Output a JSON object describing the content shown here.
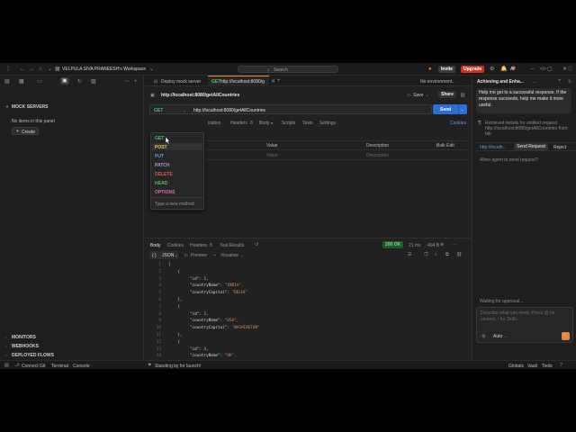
{
  "titlebar": {
    "workspace": "VELPULA SIVA PRANEESH's Workspace",
    "search_placeholder": "Search",
    "invite": "Invite",
    "upgrade": "Upgrade"
  },
  "left": {
    "section_title": "MOCK SERVERS",
    "empty": "No items in this panel",
    "create": "Create",
    "bottom_sections": [
      "MONITORS",
      "WEBHOOKS",
      "DEPLOYED FLOWS"
    ]
  },
  "tabs": {
    "tab1": "Deploy mock server",
    "tab2_method": "GET",
    "tab2_label": "http://localhost:8080/g",
    "no_environment": "No environment"
  },
  "request": {
    "title": "http://localhost:8080/getAllCountries",
    "save": "Save",
    "share": "Share",
    "method": "GET",
    "url": "http://localhost:8080/getAllCountries",
    "send": "Send",
    "subtabs": [
      "ization",
      "Headers",
      "8",
      "Body",
      "Scripts",
      "Tests",
      "Settings"
    ],
    "cookies": "Cookies",
    "params_headers": [
      "Value",
      "Description",
      "Bulk Edit"
    ],
    "params_placeholders": [
      "Value",
      "Description"
    ]
  },
  "methods_dropdown": {
    "items": [
      {
        "label": "GET",
        "color": "#4fbf6a"
      },
      {
        "label": "POST",
        "color": "#e3c74a"
      },
      {
        "label": "PUT",
        "color": "#6b9be0"
      },
      {
        "label": "PATCH",
        "color": "#b48de0"
      },
      {
        "label": "DELETE",
        "color": "#e05d5d"
      },
      {
        "label": "HEAD",
        "color": "#4fbf6a"
      },
      {
        "label": "OPTIONS",
        "color": "#d96ab1"
      }
    ],
    "type_new": "Type a new method"
  },
  "response": {
    "tabs": [
      "Body",
      "Cookies",
      "Headers",
      "8",
      "Test Results"
    ],
    "status": "200 OK",
    "time": "21 ms",
    "size": "404 B",
    "format": "JSON",
    "preview": "Preview",
    "visualize": "Visualize",
    "lines": [
      {
        "n": "1",
        "t": "["
      },
      {
        "n": "2",
        "t": "    {"
      },
      {
        "n": "3",
        "k": "\"id\"",
        "v": "1,",
        "type": "num"
      },
      {
        "n": "4",
        "k": "\"countryName\"",
        "v": "\"INDIA\",",
        "type": "str"
      },
      {
        "n": "5",
        "k": "\"countryCapital\"",
        "v": "\"DELHI\"",
        "type": "str"
      },
      {
        "n": "6",
        "t": "    },"
      },
      {
        "n": "7",
        "t": "    {"
      },
      {
        "n": "8",
        "k": "\"id\"",
        "v": "2,",
        "type": "num"
      },
      {
        "n": "9",
        "k": "\"countryName\"",
        "v": "\"USA\",",
        "type": "str"
      },
      {
        "n": "10",
        "k": "\"countryCapital\"",
        "v": "\"WASHINGTON\"",
        "type": "str"
      },
      {
        "n": "11",
        "t": "    },"
      },
      {
        "n": "12",
        "t": "    {"
      },
      {
        "n": "13",
        "k": "\"id\"",
        "v": "3,",
        "type": "num"
      },
      {
        "n": "14",
        "k": "\"countryName\"",
        "v": "\"UK\",",
        "type": "str"
      }
    ]
  },
  "ai": {
    "title": "Achieving and Enha...",
    "ai_label": "AI",
    "message": "Help me get to a successful response. If the response succeeds, help me make it more useful.",
    "retrieved": "Retrieved details for untitled request http://localhost:8080/getAllCountries from tab",
    "url_chip": "http://localh...",
    "send_request": "Send Request",
    "reject": "Reject",
    "allow": "Allow agent to send request?",
    "waiting": "Waiting for approval...",
    "input_placeholder": "Describe what you need. Press @ for context, / for Skills.",
    "auto": "Auto"
  },
  "statusbar": {
    "connect_git": "Connect Git",
    "terminal": "Terminal",
    "console": "Console",
    "standing": "Standing by for launch!",
    "globals": "Globals",
    "vault": "Vault",
    "tools": "Tools"
  }
}
